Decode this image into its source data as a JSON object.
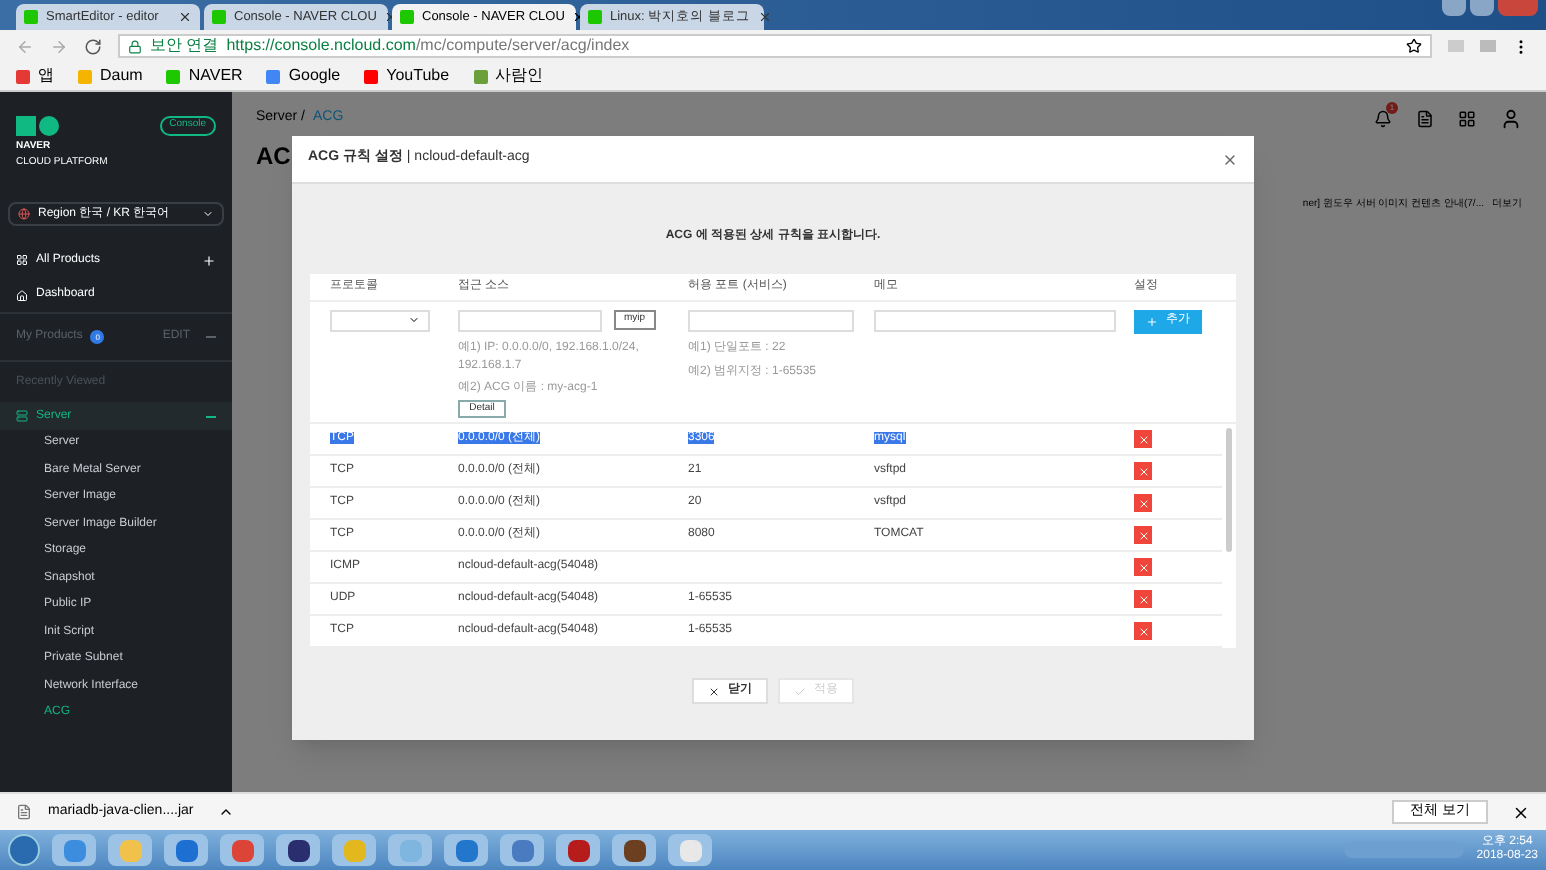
{
  "browser": {
    "tabs": [
      {
        "title": "SmartEditor - editor",
        "selected": false
      },
      {
        "title": "Console - NAVER CLOU",
        "selected": false
      },
      {
        "title": "Console - NAVER CLOU",
        "selected": true
      },
      {
        "title": "Linux: 박지호의 블로그",
        "selected": false
      }
    ],
    "security_label": "보안 연결",
    "url_host": "https://console.ncloud.com",
    "url_path": "/mc/compute/server/acg/index",
    "bookmarks": [
      {
        "label": "앱",
        "color": "#e53935"
      },
      {
        "label": "Daum",
        "color": "#f5b400"
      },
      {
        "label": "NAVER",
        "color": "#1ec800"
      },
      {
        "label": "Google",
        "color": "#4285f4"
      },
      {
        "label": "YouTube",
        "color": "#ff0000"
      },
      {
        "label": "사람인",
        "color": "#6a9f3a"
      }
    ]
  },
  "sidebar": {
    "logo_line1": "NAVER",
    "logo_line2": "CLOUD PLATFORM",
    "console_badge": "Console",
    "region": "Region 한국 / KR 한국어",
    "all_products": "All Products",
    "dashboard": "Dashboard",
    "my_products": "My Products",
    "my_products_count": "0",
    "edit": "EDIT",
    "recently_viewed": "Recently Viewed",
    "section": "Server",
    "expanded": true,
    "items": [
      {
        "label": "Server",
        "selected": false
      },
      {
        "label": "Bare Metal Server",
        "selected": false
      },
      {
        "label": "Server Image",
        "selected": false
      },
      {
        "label": "Server Image Builder",
        "selected": false
      },
      {
        "label": "Storage",
        "selected": false
      },
      {
        "label": "Snapshot",
        "selected": false
      },
      {
        "label": "Public IP",
        "selected": false
      },
      {
        "label": "Init Script",
        "selected": false
      },
      {
        "label": "Private Subnet",
        "selected": false
      },
      {
        "label": "Network Interface",
        "selected": false
      },
      {
        "label": "ACG",
        "selected": true
      }
    ]
  },
  "background": {
    "breadcrumb_1": "Server /",
    "breadcrumb_2": "ACG",
    "title": "AC",
    "notice": "ner] 윈도우 서버 이미지 컨텐츠 안내(7/...",
    "more": "더보기",
    "notification_count": "1"
  },
  "dialog": {
    "title": "ACG 규칙 설정",
    "subtitle": "| ncloud-default-acg",
    "description": "ACG 에 적용된 상세 규칙을 표시합니다.",
    "columns": [
      "프로토콜",
      "접근 소스",
      "허용 포트 (서비스)",
      "메모",
      "설정"
    ],
    "myip_button": "myip",
    "add_button": "추가",
    "source_hint_1": "예1) IP: 0.0.0.0/0, 192.168.1.0/24, 192.168.1.7",
    "source_hint_2": "예2) ACG 이름 : my-acg-1",
    "detail_button": "Detail",
    "port_hint_1": "예1) 단일포트 : 22",
    "port_hint_2": "예2) 범위지정 : 1-65535",
    "rows": [
      {
        "protocol": "TCP",
        "source": "0.0.0.0/0 (전체)",
        "port": "3306",
        "memo": "mysql",
        "selected": true
      },
      {
        "protocol": "TCP",
        "source": "0.0.0.0/0 (전체)",
        "port": "21",
        "memo": "vsftpd",
        "selected": false
      },
      {
        "protocol": "TCP",
        "source": "0.0.0.0/0 (전체)",
        "port": "20",
        "memo": "vsftpd",
        "selected": false
      },
      {
        "protocol": "TCP",
        "source": "0.0.0.0/0 (전체)",
        "port": "8080",
        "memo": "TOMCAT",
        "selected": false
      },
      {
        "protocol": "ICMP",
        "source": "ncloud-default-acg(54048)",
        "selected": false
      },
      {
        "protocol": "UDP",
        "source": "ncloud-default-acg(54048)",
        "port": "1-65535",
        "selected": false
      },
      {
        "protocol": "TCP",
        "source": "ncloud-default-acg(54048)",
        "port": "1-65535",
        "selected": false
      }
    ],
    "close_button": "닫기",
    "apply_button": "적용",
    "apply_disabled": true
  },
  "download_bar": {
    "file": "mariadb-java-clien....jar",
    "show_all": "전체 보기"
  },
  "taskbar": {
    "time": "오후 2:54",
    "date": "2018-08-23"
  }
}
